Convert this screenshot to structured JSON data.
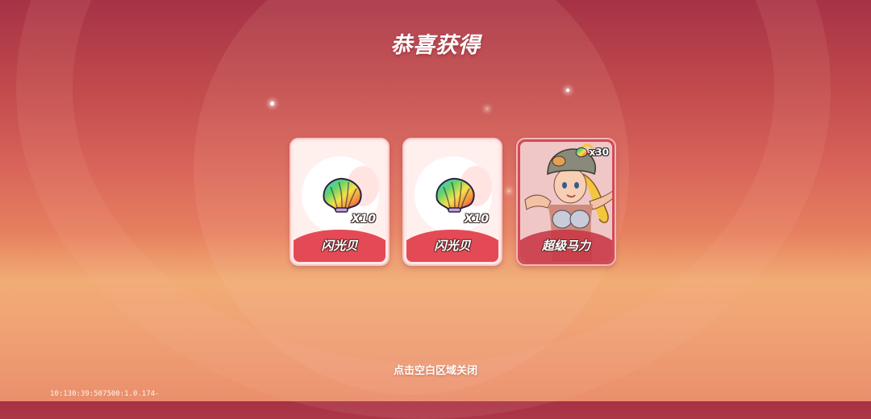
{
  "title": "恭喜获得",
  "rewards": [
    {
      "name": "闪光贝",
      "quantity": "X10",
      "icon": "rainbow-shell-icon"
    },
    {
      "name": "闪光贝",
      "quantity": "X10",
      "icon": "rainbow-shell-icon"
    },
    {
      "name": "超级马力",
      "quantity": "x30",
      "icon": "rainbow-shell-icon",
      "type": "character"
    }
  ],
  "close_hint": "点击空白区域关闭",
  "version": "10:130:39:507500:1.0.174-",
  "colors": {
    "card_red": "#e44a55",
    "card_bg": "#fff0ee",
    "text": "#ffffff"
  }
}
